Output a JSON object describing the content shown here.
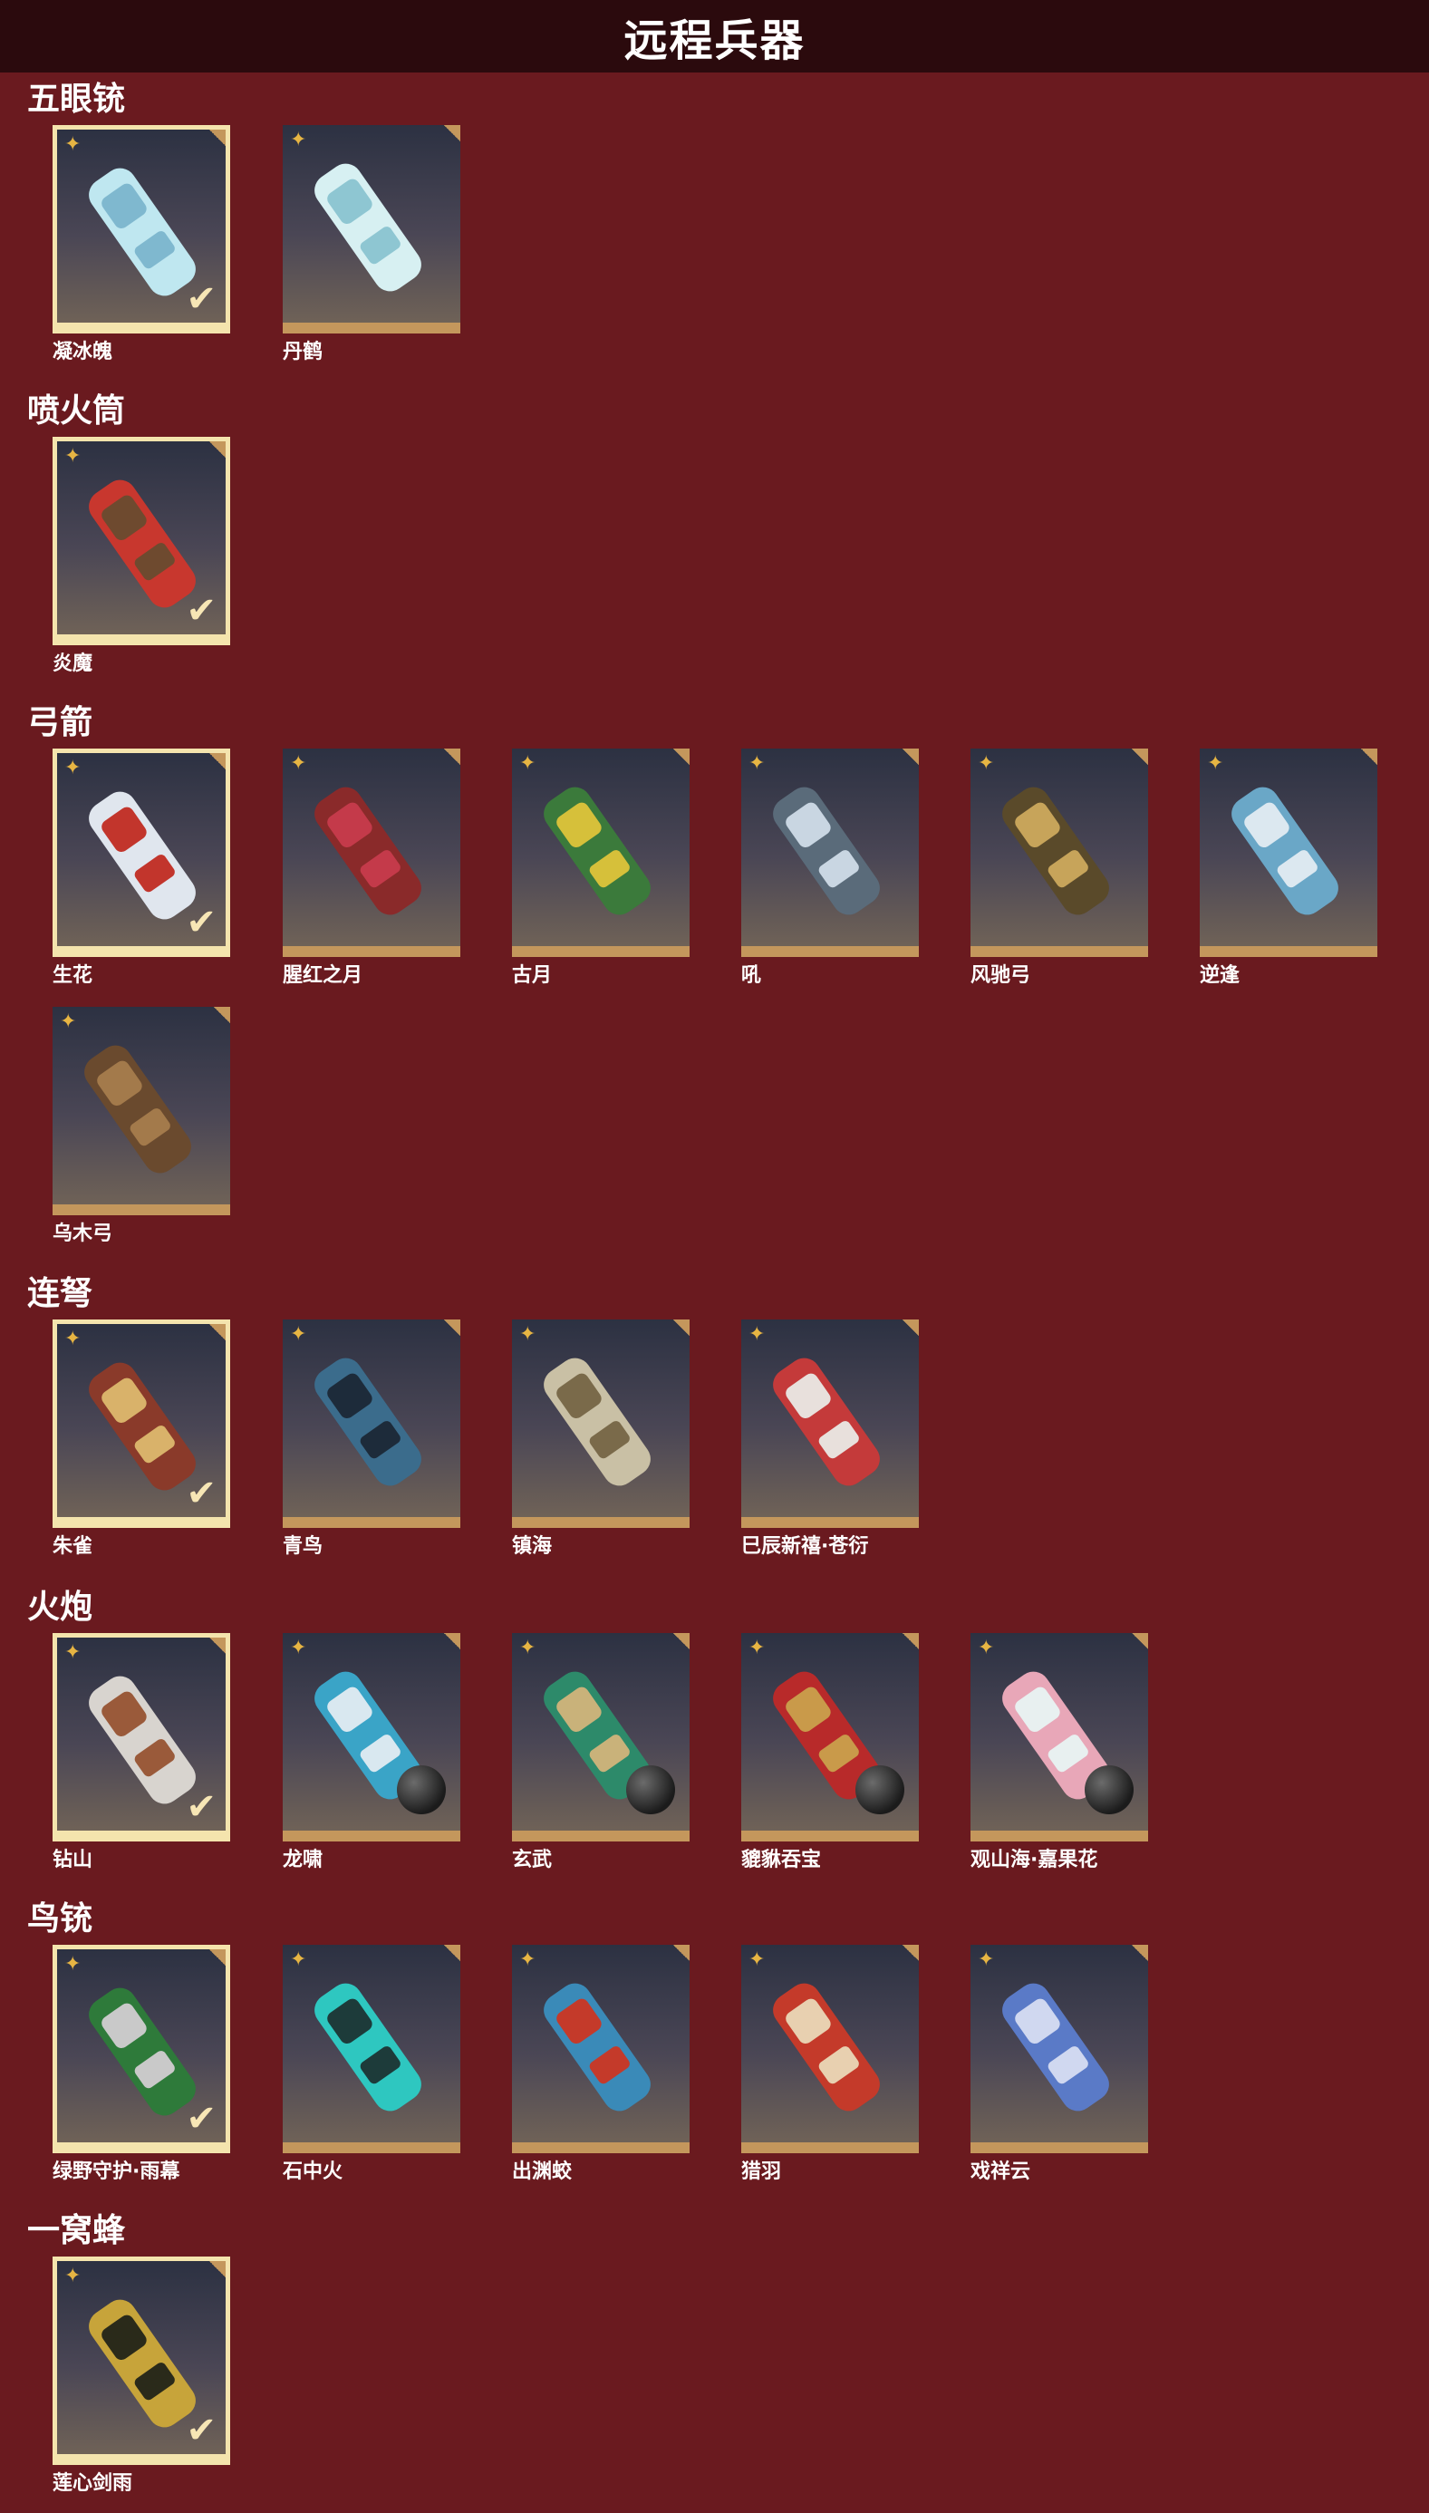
{
  "header": {
    "title": "远程兵器"
  },
  "icons": {
    "tier_icon": "four-point-star-icon",
    "owned_icon": "check-icon"
  },
  "colors": {
    "background": "#6a1a1f",
    "header": "#2b0a0d",
    "tile_border": "#c4975c",
    "selected_border": "#f4e4ad"
  },
  "sections": [
    {
      "title": "五眼铳",
      "items": [
        {
          "name": "凝冰魄",
          "owned": true
        },
        {
          "name": "丹鹤",
          "owned": false
        }
      ]
    },
    {
      "title": "喷火筒",
      "items": [
        {
          "name": "炎魔",
          "owned": true
        }
      ]
    },
    {
      "title": "弓箭",
      "items": [
        {
          "name": "生花",
          "owned": true
        },
        {
          "name": "腥红之月",
          "owned": false
        },
        {
          "name": "古月",
          "owned": false
        },
        {
          "name": "吼",
          "owned": false
        },
        {
          "name": "风驰弓",
          "owned": false
        },
        {
          "name": "逆逢",
          "owned": false
        },
        {
          "name": "乌木弓",
          "owned": false
        }
      ]
    },
    {
      "title": "连弩",
      "items": [
        {
          "name": "朱雀",
          "owned": true
        },
        {
          "name": "青鸟",
          "owned": false
        },
        {
          "name": "镇海",
          "owned": false
        },
        {
          "name": "巳辰新禧·苍衍",
          "owned": false
        }
      ]
    },
    {
      "title": "火炮",
      "items": [
        {
          "name": "钻山",
          "owned": true
        },
        {
          "name": "龙啸",
          "owned": false
        },
        {
          "name": "玄武",
          "owned": false
        },
        {
          "name": "貔貅吞宝",
          "owned": false
        },
        {
          "name": "观山海·嘉果花",
          "owned": false
        }
      ]
    },
    {
      "title": "鸟铳",
      "items": [
        {
          "name": "绿野守护·雨幕",
          "owned": true
        },
        {
          "name": "石中火",
          "owned": false
        },
        {
          "name": "出渊蛟",
          "owned": false
        },
        {
          "name": "猎羽",
          "owned": false
        },
        {
          "name": "戏祥云",
          "owned": false
        }
      ]
    },
    {
      "title": "一窝蜂",
      "items": [
        {
          "name": "莲心剑雨",
          "owned": true
        }
      ]
    }
  ]
}
